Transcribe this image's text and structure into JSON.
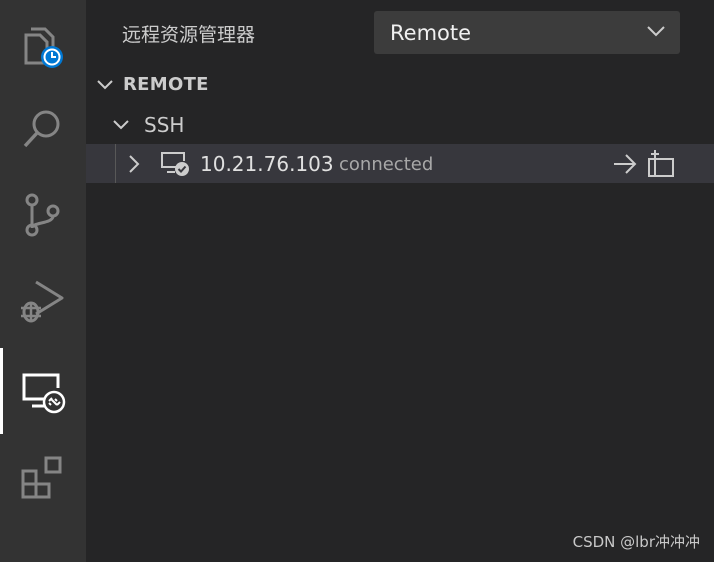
{
  "activity_bar": {
    "items": [
      {
        "name": "explorer-history",
        "active": false
      },
      {
        "name": "search",
        "active": false
      },
      {
        "name": "source-control",
        "active": false
      },
      {
        "name": "run-debug",
        "active": false
      },
      {
        "name": "remote-explorer",
        "active": true
      },
      {
        "name": "extensions",
        "active": false
      }
    ]
  },
  "sidebar": {
    "title": "远程资源管理器",
    "dropdown": {
      "selected": "Remote"
    },
    "section": {
      "title": "REMOTE"
    },
    "group": {
      "label": "SSH"
    },
    "host": {
      "address": "10.21.76.103",
      "status": "connected"
    }
  },
  "watermark": "CSDN @lbr冲冲冲",
  "colors": {
    "activity_bg": "#333333",
    "sidebar_bg": "#252526",
    "selected_row_bg": "#37373d",
    "badge_blue": "#0078d4"
  }
}
